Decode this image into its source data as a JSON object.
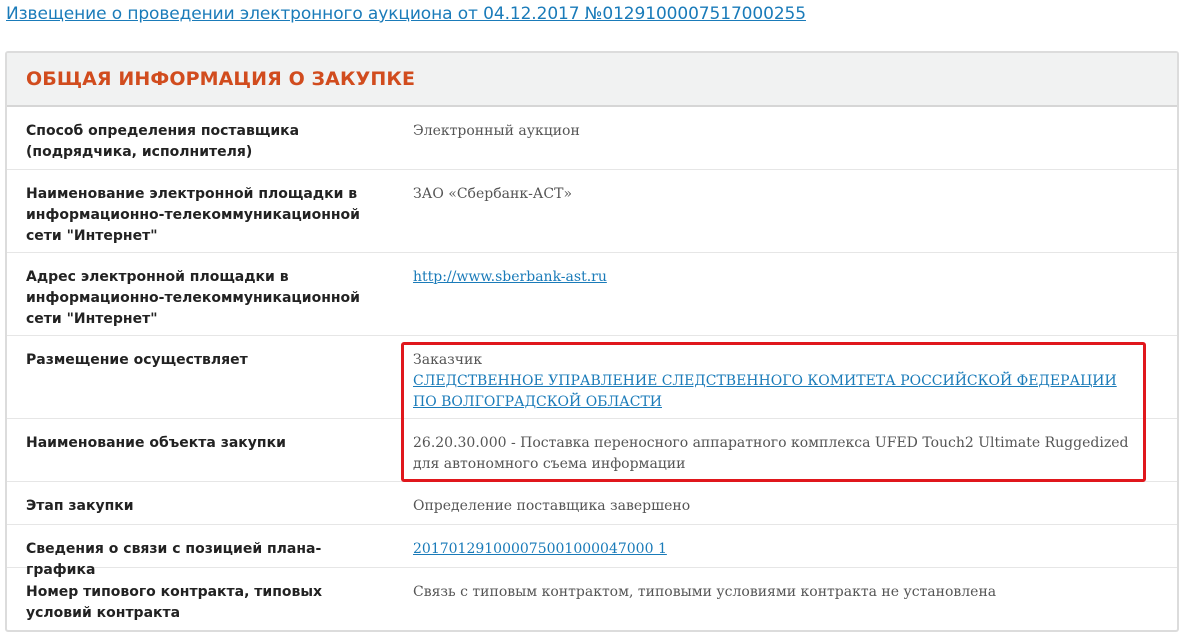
{
  "notice_link": "Извещение о проведении электронного аукциона от 04.12.2017 №0129100007517000255",
  "section_title": "ОБЩАЯ ИНФОРМАЦИЯ О ЗАКУПКЕ",
  "rows": [
    {
      "label": "Способ определения поставщика (подрядчика, исполнителя)",
      "value": "Электронный аукцион"
    },
    {
      "label": "Наименование электронной площадки в информационно-телекоммуникационной сети \"Интернет\"",
      "value": "ЗАО «Сбербанк-АСТ»"
    },
    {
      "label": "Адрес электронной площадки в информационно-телекоммуникационной сети \"Интернет\"",
      "value_link": "http://www.sberbank-ast.ru"
    },
    {
      "label": "Размещение осуществляет",
      "value": "Заказчик",
      "value_link": "СЛЕДСТВЕННОЕ УПРАВЛЕНИЕ СЛЕДСТВЕННОГО КОМИТЕТА РОССИЙСКОЙ ФЕДЕРАЦИИ ПО ВОЛГОГРАДСКОЙ ОБЛАСТИ"
    },
    {
      "label": "Наименование объекта закупки",
      "value": "26.20.30.000 - Поставка переносного аппаратного комплекса UFED Touch2 Ultimate Ruggedized для автономного съема информации"
    },
    {
      "label": "Этап закупки",
      "value": "Определение поставщика завершено"
    },
    {
      "label": "Сведения о связи с позицией плана-графика",
      "value_link": "201701291000075001000047000 1"
    },
    {
      "label": "Номер типового контракта, типовых условий контракта",
      "value": "Связь с типовым контрактом, типовыми условиями контракта не установлена"
    }
  ],
  "colors": {
    "link": "#1a7bb9",
    "title": "#d14c1e",
    "highlight": "#e0171c",
    "header_bg": "#f1f2f2"
  }
}
